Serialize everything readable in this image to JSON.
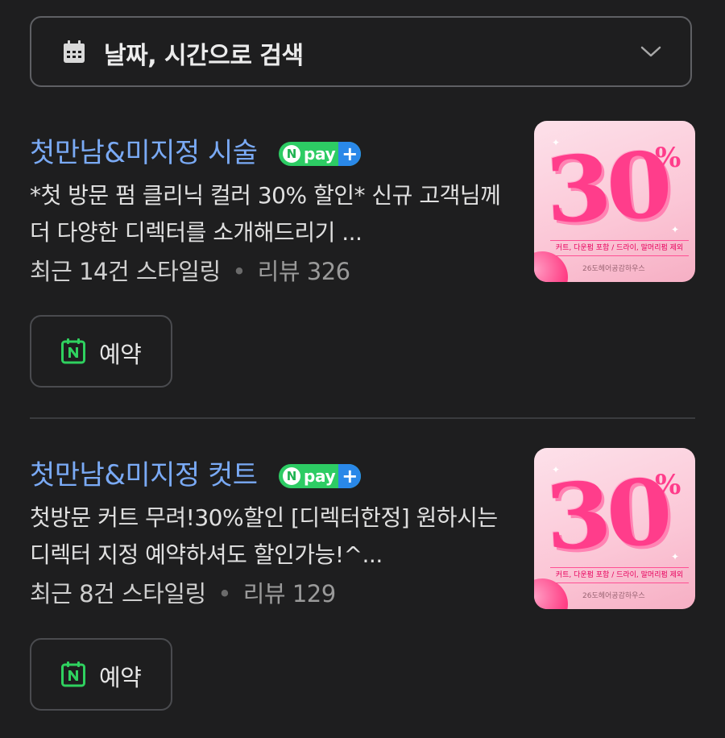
{
  "date_search": {
    "label": "날짜, 시간으로 검색",
    "icons": [
      "calendar-icon",
      "chevron-down-icon"
    ]
  },
  "items": [
    {
      "title": "첫만남&미지정 시술",
      "npay_n": "N",
      "npay_text": "pay",
      "npay_plus": "+",
      "desc": "*첫 방문 펌 클리닉 컬러 30% 할인* 신규 고객님께 더 다양한 디렉터를 소개해드리기 ...",
      "styling_prefix": "최근 ",
      "styling_count": "14",
      "styling_suffix": "건 스타일링",
      "review_label": "리뷰 ",
      "review_count": "326",
      "thumb": {
        "big": "30",
        "percent": "%",
        "ribbon": "커트, 다운펌 포함 / 드라이, 말머리펌 제외",
        "shop": "26도헤어공감하우스"
      },
      "reserve_label": "예약"
    },
    {
      "title": "첫만남&미지정 컷트",
      "npay_n": "N",
      "npay_text": "pay",
      "npay_plus": "+",
      "desc": "첫방문 커트 무려!30%할인 [디렉터한정] 원하시는 디렉터 지정 예약하셔도 할인가능!^...",
      "styling_prefix": "최근 ",
      "styling_count": "8",
      "styling_suffix": "건 스타일링",
      "review_label": "리뷰 ",
      "review_count": "129",
      "thumb": {
        "big": "30",
        "percent": "%",
        "ribbon": "커트, 다운펌 포함 / 드라이, 말머리펌 제외",
        "shop": "26도헤어공감하우스"
      },
      "reserve_label": "예약"
    }
  ],
  "colors": {
    "background": "#1e1e1f",
    "title_link": "#7aaaf5",
    "npay_green": "#2dcc64",
    "npay_blue": "#2a88e8",
    "naver_green": "#2fd15f"
  }
}
